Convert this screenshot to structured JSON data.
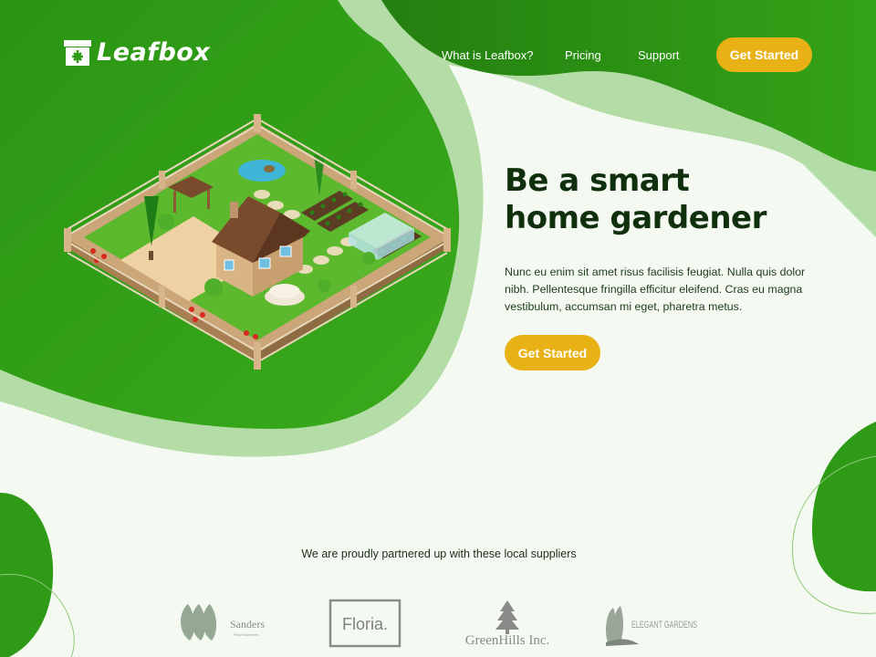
{
  "brand": {
    "name": "Leafbox"
  },
  "nav": {
    "links": [
      "What is Leafbox?",
      "Pricing",
      "Support"
    ],
    "cta": "Get Started"
  },
  "hero": {
    "title_line1": "Be a smart",
    "title_line2": "home gardener",
    "body": "Nunc eu enim sit amet risus facilisis feugiat. Nulla quis dolor nibh. Pellentesque fringilla efficitur eleifend. Cras eu magna vestibulum, accumsan mi eget, pharetra metus.",
    "cta": "Get Started"
  },
  "partners": {
    "title": "We are proudly partnered up with these local suppliers",
    "logos": [
      {
        "name": "Sanders",
        "tagline": "Plant Nurseries"
      },
      {
        "name": "Floria."
      },
      {
        "name": "GreenHills Inc."
      },
      {
        "name": "ELEGANT GARDENS"
      }
    ]
  },
  "colors": {
    "primary_green": "#2e9a16",
    "dark_green": "#1f7a0f",
    "light_green": "#a8d59a",
    "accent_yellow": "#e8b115",
    "background": "#f4faf1",
    "heading": "#10300d"
  }
}
